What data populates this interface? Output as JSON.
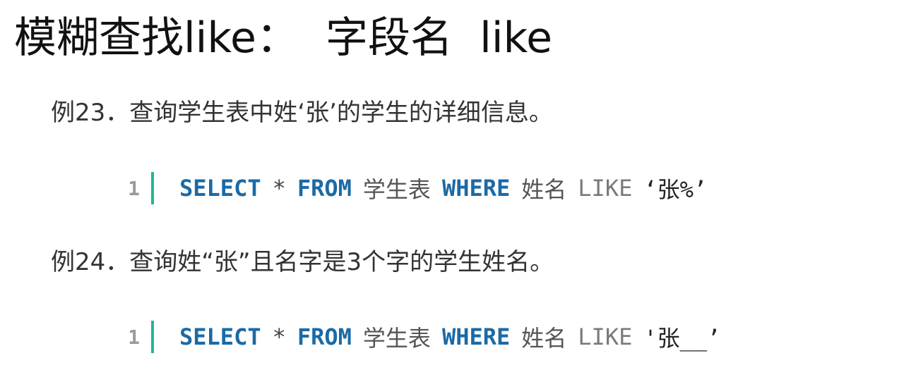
{
  "title": "模糊查找like：  字段名  like",
  "examples": [
    {
      "text": "例23．查询学生表中姓‘张’的学生的详细信息。",
      "code": {
        "line_number": "1",
        "select": "SELECT",
        "star": "*",
        "from": "FROM",
        "table": "学生表",
        "where": "WHERE",
        "column": "姓名",
        "like": "LIKE",
        "pattern": "‘张%’"
      }
    },
    {
      "text": "例24．查询姓“张”且名字是3个字的学生姓名。",
      "code": {
        "line_number": "1",
        "select": "SELECT",
        "star": "*",
        "from": "FROM",
        "table": "学生表",
        "where": "WHERE",
        "column": "姓名",
        "like": "LIKE",
        "pattern": "'张__’"
      }
    }
  ]
}
